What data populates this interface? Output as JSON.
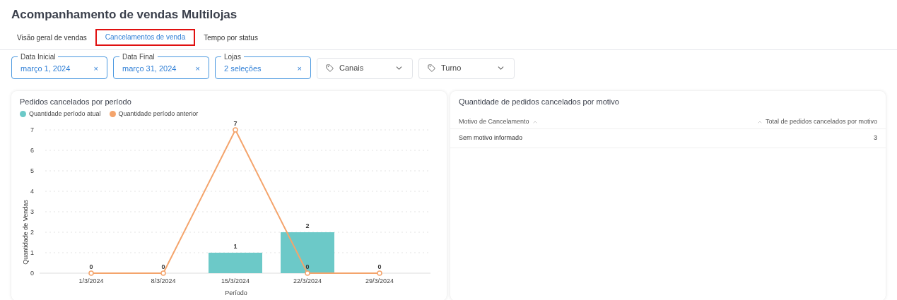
{
  "page_title": "Acompanhamento de vendas Multilojas",
  "tabs": [
    {
      "label": "Visão geral de vendas",
      "selected": false
    },
    {
      "label": "Cancelamentos de venda",
      "selected": true
    },
    {
      "label": "Tempo por status",
      "selected": false
    }
  ],
  "filters": [
    {
      "kind": "field",
      "label": "Data Inicial",
      "value": "março 1, 2024"
    },
    {
      "kind": "field",
      "label": "Data Final",
      "value": "março 31, 2024"
    },
    {
      "kind": "field",
      "label": "Lojas",
      "value": "2 seleções"
    },
    {
      "kind": "select",
      "value": "Canais"
    },
    {
      "kind": "select",
      "value": "Turno"
    }
  ],
  "clear_symbol": "×",
  "chart_card": {
    "title": "Pedidos cancelados por período",
    "chart_data": {
      "type": "bar",
      "xlabel": "Período",
      "ylabel": "Quantidade de Vendas",
      "categories": [
        "1/3/2024",
        "8/3/2024",
        "15/3/2024",
        "22/3/2024",
        "29/3/2024"
      ],
      "ylim": [
        0,
        7
      ],
      "yticks": [
        0,
        1,
        2,
        3,
        4,
        5,
        6,
        7
      ],
      "grid": true,
      "series": [
        {
          "name": "Quantidade período atual",
          "type": "bar",
          "color": "#6cc9c8",
          "values": [
            0,
            0,
            1,
            2,
            0
          ],
          "value_labels": [
            null,
            null,
            "1",
            "2",
            null
          ]
        },
        {
          "name": "Quantidade período anterior",
          "type": "line",
          "marker": "circle",
          "color": "#f4a46c",
          "values": [
            0,
            0,
            7,
            0,
            0
          ],
          "value_labels": [
            "0",
            "0",
            "7",
            "0",
            "0"
          ]
        }
      ]
    }
  },
  "table_card": {
    "title": "Quantidade de pedidos cancelados por motivo",
    "columns": [
      "Motivo de Cancelamento",
      "Total de pedidos cancelados por motivo"
    ],
    "rows": [
      [
        "Sem motivo informado",
        "3"
      ]
    ]
  }
}
